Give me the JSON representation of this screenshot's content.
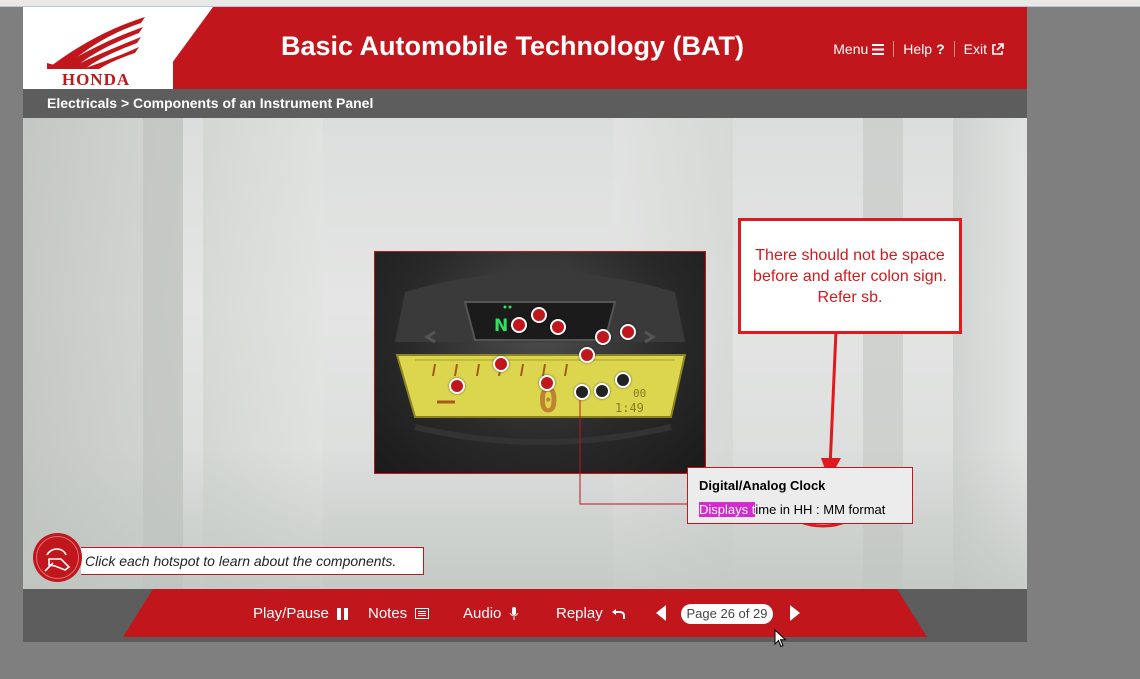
{
  "header": {
    "logo_text": "HONDA",
    "title": "Basic Automobile Technology (BAT)",
    "nav": {
      "menu_label": "Menu",
      "help_label": "Help",
      "exit_label": "Exit"
    }
  },
  "breadcrumb": "Electricals > Components of an Instrument Panel",
  "tooltip": {
    "title": "Digital/Analog Clock",
    "body_highlight": "Displays t",
    "body_rest": "ime in HH : MM format"
  },
  "annotation": {
    "text": "There should not be space before and after colon sign. Refer sb."
  },
  "instruction": "Click each hotspot to learn about the components.",
  "footer": {
    "play_pause_label": "Play/Pause",
    "notes_label": "Notes",
    "audio_label": "Audio",
    "replay_label": "Replay",
    "page_indicator": "Page 26 of 29"
  },
  "icons": {
    "menu": "hamburger-icon",
    "help": "question-icon",
    "exit": "external-link-icon",
    "play_pause": "pause-icon",
    "notes": "notes-icon",
    "audio": "microphone-icon",
    "replay": "replay-arrow-icon",
    "prev": "triangle-left-icon",
    "next": "triangle-right-icon",
    "instruction": "touch-hand-icon"
  },
  "colors": {
    "brand_red": "#c0161c",
    "bar_gray": "#5d5d5d",
    "annotation_red": "#e0191f",
    "highlight_magenta": "#d52ad2"
  }
}
